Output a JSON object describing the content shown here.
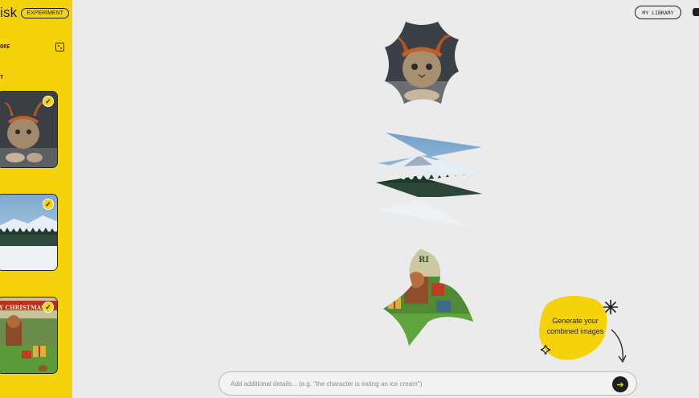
{
  "brand": {
    "name_partial": "isk",
    "badge": "EXPERIMENT"
  },
  "sidebar": {
    "more_label_partial": "ORE",
    "section_label_partial": "T",
    "thumbs": [
      {
        "name": "subject-cat",
        "checked": true
      },
      {
        "name": "scene-mountains",
        "checked": true
      },
      {
        "name": "style-christmas",
        "checked": true,
        "caption": "Y CHRISTMAS"
      }
    ]
  },
  "header": {
    "library_label": "MY LIBRARY"
  },
  "tooltip": {
    "text": "Generate your combined images"
  },
  "prompt": {
    "placeholder": "Add additional details... (e.g. \"the character is eating an ice cream\")",
    "value": ""
  },
  "colors": {
    "accent": "#f6d20a",
    "ink": "#1f1f1f",
    "canvas": "#ebebeb"
  },
  "icons": [
    "dice-icon",
    "check-icon",
    "send-arrow-icon",
    "sparkle-icon",
    "star-icon",
    "curved-arrow-icon"
  ]
}
